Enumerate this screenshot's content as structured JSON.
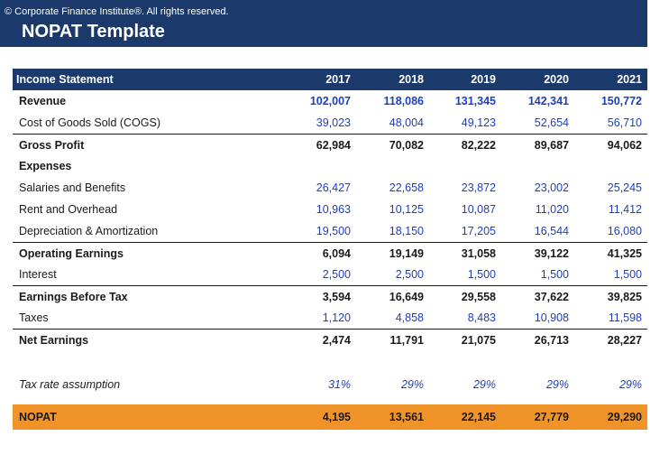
{
  "banner": {
    "copyright": "© Corporate Finance Institute®. All rights reserved.",
    "title": "NOPAT Template"
  },
  "table": {
    "header_label": "Income Statement",
    "years": [
      "2017",
      "2018",
      "2019",
      "2020",
      "2021"
    ],
    "rows": [
      {
        "label": "Revenue",
        "values": [
          "102,007",
          "118,086",
          "131,345",
          "142,341",
          "150,772"
        ]
      },
      {
        "label": "Cost of Goods Sold (COGS)",
        "values": [
          "39,023",
          "48,004",
          "49,123",
          "52,654",
          "56,710"
        ]
      },
      {
        "label": "Gross Profit",
        "values": [
          "62,984",
          "70,082",
          "82,222",
          "89,687",
          "94,062"
        ]
      },
      {
        "label": "Expenses",
        "values": [
          "",
          "",
          "",
          "",
          ""
        ]
      },
      {
        "label": "Salaries and Benefits",
        "values": [
          "26,427",
          "22,658",
          "23,872",
          "23,002",
          "25,245"
        ]
      },
      {
        "label": "Rent and Overhead",
        "values": [
          "10,963",
          "10,125",
          "10,087",
          "11,020",
          "11,412"
        ]
      },
      {
        "label": "Depreciation & Amortization",
        "values": [
          "19,500",
          "18,150",
          "17,205",
          "16,544",
          "16,080"
        ]
      },
      {
        "label": "Operating Earnings",
        "values": [
          "6,094",
          "19,149",
          "31,058",
          "39,122",
          "41,325"
        ]
      },
      {
        "label": "Interest",
        "values": [
          "2,500",
          "2,500",
          "1,500",
          "1,500",
          "1,500"
        ]
      },
      {
        "label": "Earnings Before Tax",
        "values": [
          "3,594",
          "16,649",
          "29,558",
          "37,622",
          "39,825"
        ]
      },
      {
        "label": "Taxes",
        "values": [
          "1,120",
          "4,858",
          "8,483",
          "10,908",
          "11,598"
        ]
      },
      {
        "label": "Net Earnings",
        "values": [
          "2,474",
          "11,791",
          "21,075",
          "26,713",
          "28,227"
        ]
      }
    ],
    "tax_rate": {
      "label": "Tax rate assumption",
      "values": [
        "31%",
        "29%",
        "29%",
        "29%",
        "29%"
      ]
    },
    "nopat": {
      "label": "NOPAT",
      "values": [
        "4,195",
        "13,561",
        "22,145",
        "27,779",
        "29,290"
      ]
    }
  },
  "colors": {
    "banner": "#1b3a6b",
    "input_blue": "#1f3fb8",
    "nopat_orange": "#f0942a"
  }
}
